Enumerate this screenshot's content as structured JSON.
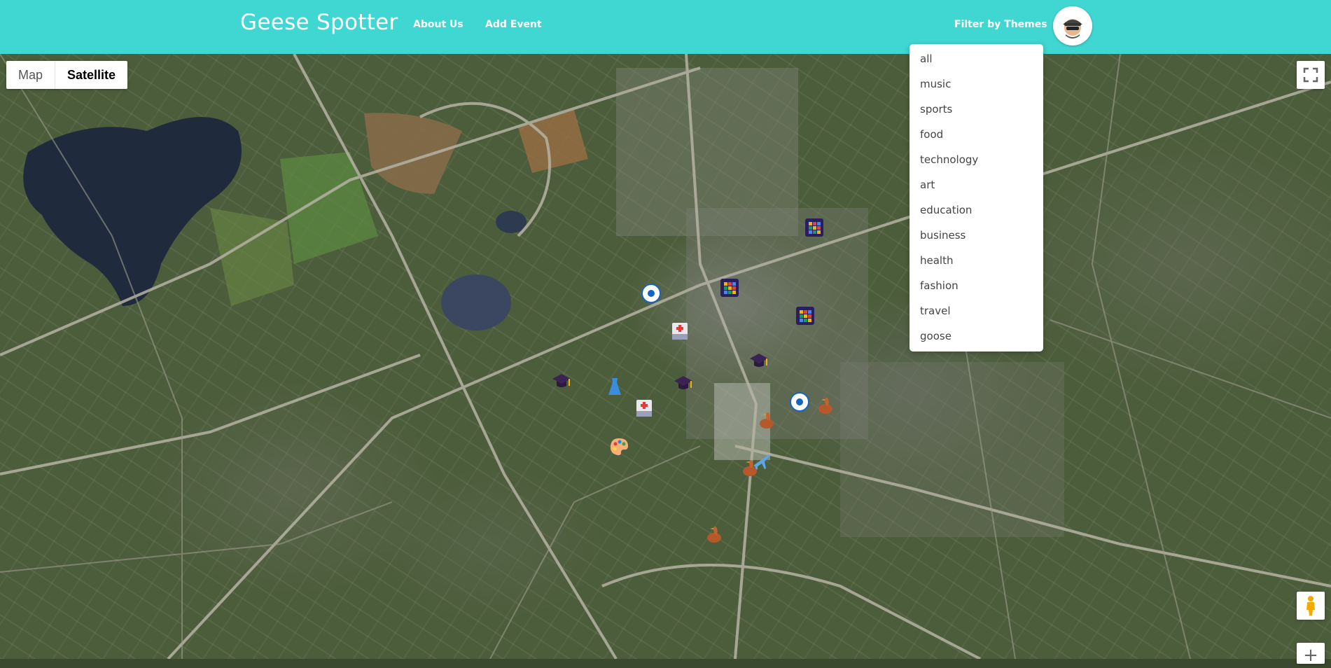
{
  "header": {
    "title": "Geese Spotter",
    "nav": {
      "about": "About Us",
      "add_event": "Add Event"
    },
    "filter_label": "Filter by Themes"
  },
  "map": {
    "type_controls": {
      "map": "Map",
      "satellite": "Satellite",
      "selected": "Satellite"
    },
    "zoom_in": "+",
    "markers": [
      {
        "category": "sports",
        "icon": "soccer-ball-icon"
      },
      {
        "category": "sports",
        "icon": "soccer-ball-icon"
      },
      {
        "category": "technology",
        "icon": "grid-icon"
      },
      {
        "category": "technology",
        "icon": "grid-icon"
      },
      {
        "category": "technology",
        "icon": "grid-icon"
      },
      {
        "category": "health",
        "icon": "hospital-icon"
      },
      {
        "category": "health",
        "icon": "hospital-icon"
      },
      {
        "category": "education",
        "icon": "graduation-cap-icon"
      },
      {
        "category": "education",
        "icon": "graduation-cap-icon"
      },
      {
        "category": "education",
        "icon": "graduation-cap-icon"
      },
      {
        "category": "fashion",
        "icon": "dress-icon"
      },
      {
        "category": "art",
        "icon": "palette-icon"
      },
      {
        "category": "travel",
        "icon": "airplane-icon"
      },
      {
        "category": "goose",
        "icon": "goose-icon"
      },
      {
        "category": "goose",
        "icon": "goose-icon"
      },
      {
        "category": "goose",
        "icon": "goose-icon"
      },
      {
        "category": "goose",
        "icon": "goose-icon"
      }
    ]
  },
  "themes": {
    "options": [
      "all",
      "music",
      "sports",
      "food",
      "technology",
      "art",
      "education",
      "business",
      "health",
      "fashion",
      "travel",
      "goose"
    ]
  },
  "colors": {
    "header_bg": "#40d6d2",
    "header_text": "#ffffff"
  }
}
